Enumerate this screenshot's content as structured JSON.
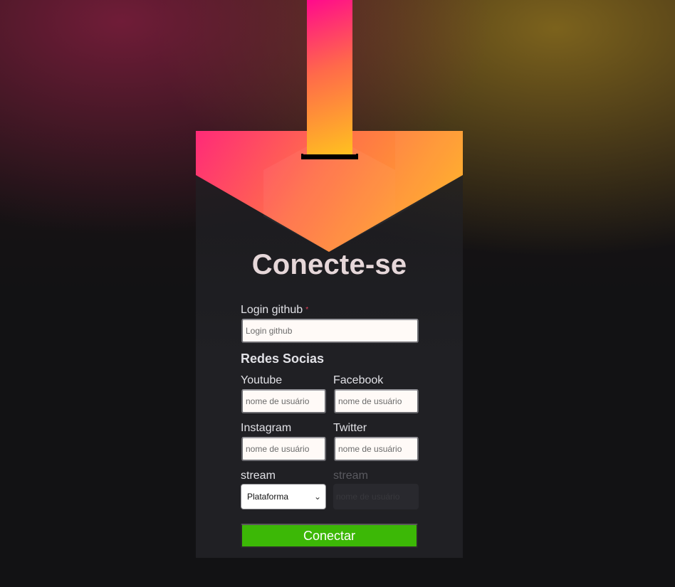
{
  "colors": {
    "background": "#121214",
    "card": "#202024",
    "brand_pink": "#ff0a8c",
    "brand_orange": "#ff6a4a",
    "brand_yellow": "#ffc21f",
    "button_green": "#3cb806",
    "required_red": "#e83f5b"
  },
  "form": {
    "title": "Conecte-se",
    "github": {
      "label": "Login github",
      "required_mark": "*",
      "placeholder": "Login github"
    },
    "socials_heading": "Redes Socias",
    "youtube": {
      "label": "Youtube",
      "placeholder": "nome de usuário"
    },
    "facebook": {
      "label": "Facebook",
      "placeholder": "nome de usuário"
    },
    "instagram": {
      "label": "Instagram",
      "placeholder": "nome de usuário"
    },
    "twitter": {
      "label": "Twitter",
      "placeholder": "nome de usuário"
    },
    "stream": {
      "label": "stream",
      "platform_selected": "Plataforma",
      "user_label": "stream",
      "user_placeholder": "nome de usuário"
    },
    "submit_label": "Conectar"
  }
}
